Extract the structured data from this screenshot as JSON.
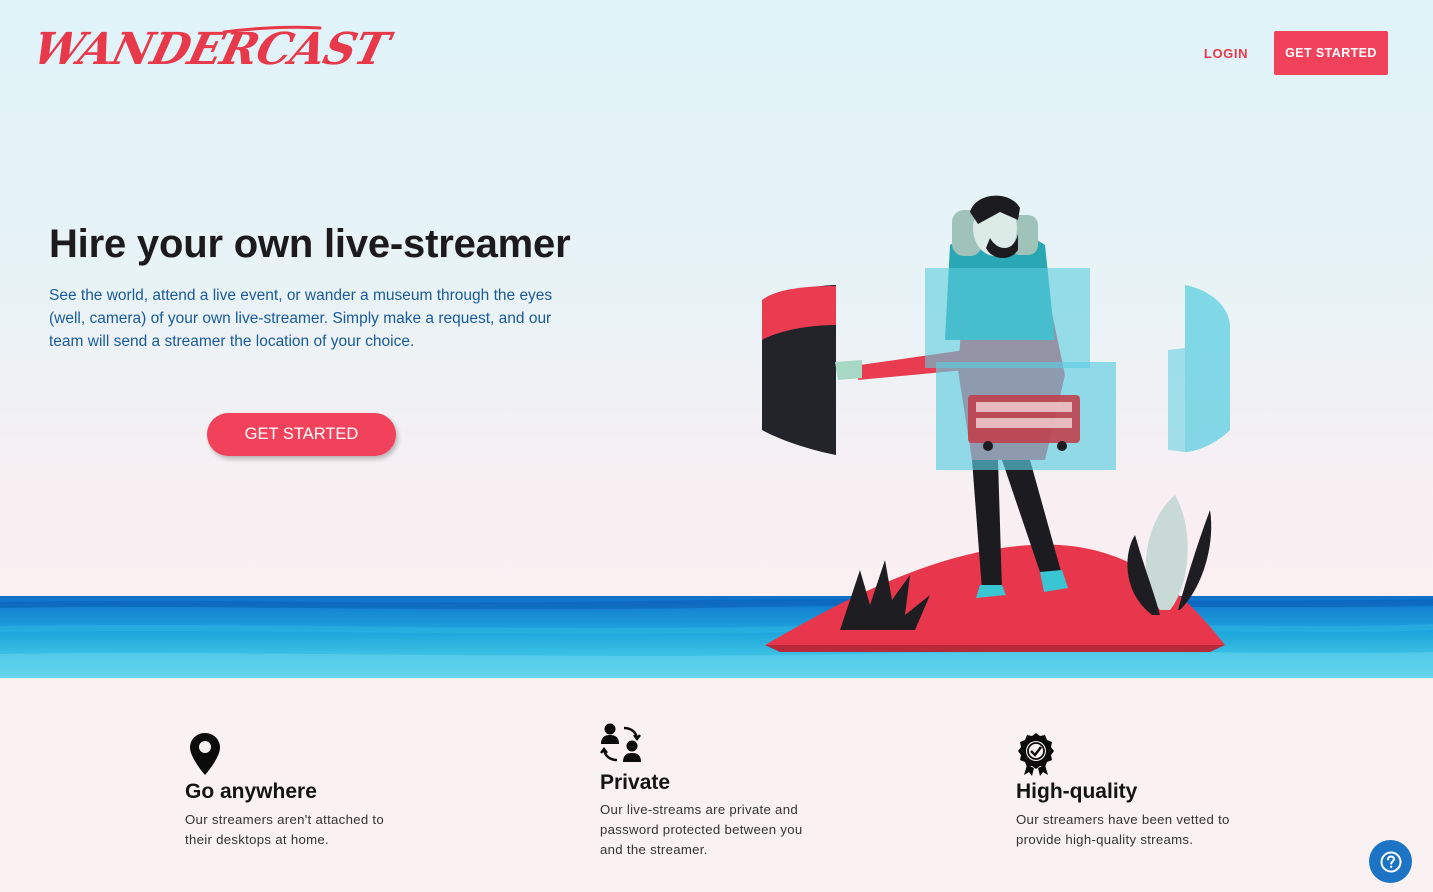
{
  "brand": {
    "logo_text": "WANDERCAST",
    "accent_color": "#f2415a"
  },
  "nav": {
    "login_label": "LOGIN",
    "cta_label": "GET STARTED"
  },
  "hero": {
    "headline": "Hire your own live-streamer",
    "subtext": "See the world, attend a live event, or wander a museum through the eyes (well, camera) of your own live-streamer. Simply make a request, and our team will send a streamer the location of your choice.",
    "cta_label": "GET STARTED"
  },
  "features": [
    {
      "icon": "map-pin-icon",
      "title": "Go anywhere",
      "description": "Our streamers aren't attached to their desktops at home."
    },
    {
      "icon": "users-swap-icon",
      "title": "Private",
      "description": "Our live-streams are private and password protected between you and the streamer."
    },
    {
      "icon": "quality-badge-icon",
      "title": "High-quality",
      "description": "Our streamers have been vetted to provide high-quality streams."
    }
  ],
  "help": {
    "icon": "help-icon"
  }
}
